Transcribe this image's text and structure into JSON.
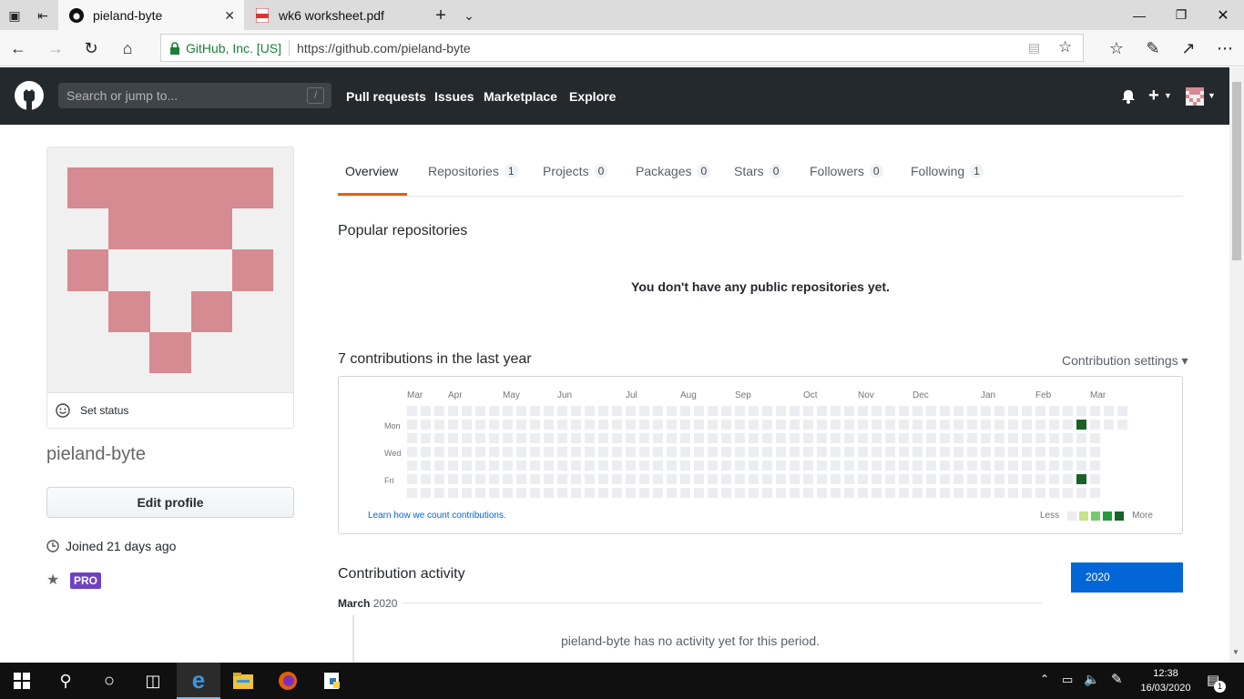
{
  "browser": {
    "tabs": [
      {
        "title": "pieland-byte",
        "active": true
      },
      {
        "title": "wk6 worksheet.pdf",
        "active": false
      }
    ],
    "site_identity": "GitHub, Inc. [US]",
    "url": "https://github.com/pieland-byte"
  },
  "github_header": {
    "search_placeholder": "Search or jump to...",
    "search_hotkey": "/",
    "nav": [
      "Pull requests",
      "Issues",
      "Marketplace",
      "Explore"
    ],
    "plus": "+"
  },
  "profile": {
    "set_status": "Set status",
    "username": "pieland-byte",
    "edit_button": "Edit profile",
    "joined": "Joined 21 days ago",
    "pro_badge": "PRO",
    "avatar_color": "#d68a91"
  },
  "tabs": [
    {
      "label": "Overview",
      "count": null
    },
    {
      "label": "Repositories",
      "count": "1"
    },
    {
      "label": "Projects",
      "count": "0"
    },
    {
      "label": "Packages",
      "count": "0"
    },
    {
      "label": "Stars",
      "count": "0"
    },
    {
      "label": "Followers",
      "count": "0"
    },
    {
      "label": "Following",
      "count": "1"
    }
  ],
  "popular": {
    "heading": "Popular repositories",
    "empty": "You don't have any public repositories yet."
  },
  "contributions": {
    "heading": "7 contributions in the last year",
    "settings": "Contribution settings ▾",
    "months": [
      "Mar",
      "Apr",
      "May",
      "Jun",
      "Jul",
      "Aug",
      "Sep",
      "Oct",
      "Nov",
      "Dec",
      "Jan",
      "Feb",
      "Mar"
    ],
    "days": [
      "Mon",
      "Wed",
      "Fri"
    ],
    "learn": "Learn how we count contributions.",
    "less": "Less",
    "more": "More",
    "colors": {
      "empty": "#ebedf0",
      "l1": "#c6e48b",
      "l2": "#7bc96f",
      "l3": "#239a3b",
      "l4": "#196127"
    }
  },
  "activity": {
    "heading": "Contribution activity",
    "year": "2020",
    "month": "March",
    "month_year": "2020",
    "empty": "pieland-byte has no activity yet for this period."
  },
  "taskbar": {
    "time": "12:38",
    "date": "16/03/2020",
    "notifications": "1"
  }
}
